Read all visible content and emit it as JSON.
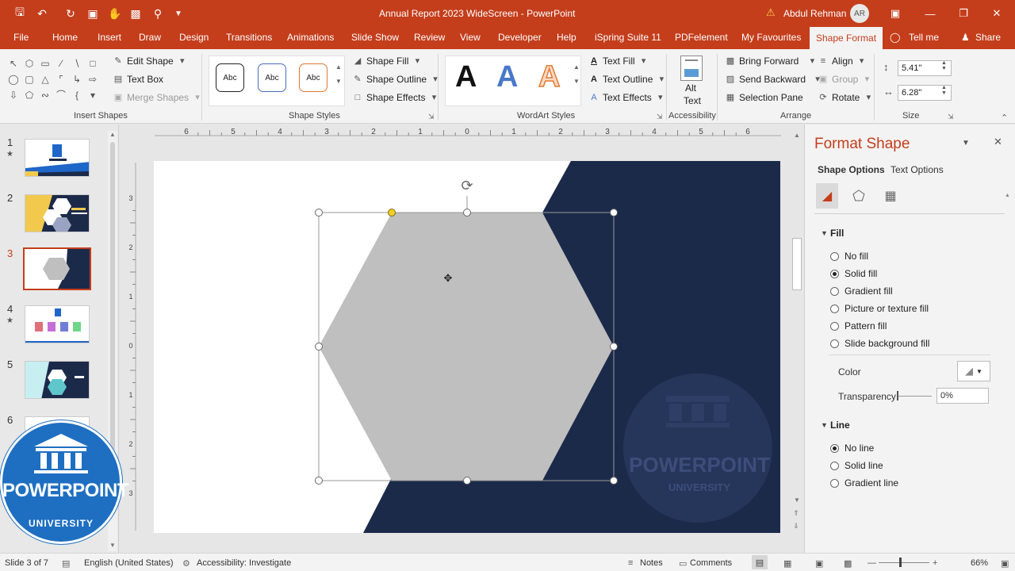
{
  "window": {
    "title": "Annual Report 2023 WideScreen  -  PowerPoint",
    "user_name": "Abdul Rehman",
    "user_initials": "AR"
  },
  "menu_tabs": [
    "File",
    "Home",
    "Insert",
    "Draw",
    "Design",
    "Transitions",
    "Animations",
    "Slide Show",
    "Review",
    "View",
    "Developer",
    "Help",
    "iSpring Suite 11",
    "PDFelement",
    "My Favourites",
    "Shape Format"
  ],
  "menu_extra": {
    "tell_me": "Tell me",
    "share": "Share"
  },
  "ribbon": {
    "insert_shapes": {
      "edit_shape": "Edit Shape",
      "text_box": "Text Box",
      "merge_shapes": "Merge Shapes",
      "label": "Insert Shapes"
    },
    "shape_styles": {
      "sample": "Abc",
      "fill": "Shape Fill",
      "outline": "Shape Outline",
      "effects": "Shape Effects",
      "label": "Shape Styles"
    },
    "wordart_styles": {
      "sample": "A",
      "text_fill": "Text Fill",
      "text_outline": "Text Outline",
      "text_effects": "Text Effects",
      "label": "WordArt Styles"
    },
    "accessibility": {
      "alt_text_1": "Alt",
      "alt_text_2": "Text",
      "label": "Accessibility"
    },
    "arrange": {
      "bring_forward": "Bring Forward",
      "send_backward": "Send Backward",
      "selection_pane": "Selection Pane",
      "align": "Align",
      "group": "Group",
      "rotate": "Rotate",
      "label": "Arrange"
    },
    "size": {
      "height": "5.41\"",
      "width": "6.28\"",
      "label": "Size"
    }
  },
  "ruler": {
    "h_labels": [
      "6",
      "5",
      "4",
      "3",
      "2",
      "1",
      "0",
      "1",
      "2",
      "3",
      "4",
      "5",
      "6"
    ],
    "v_labels": [
      "3",
      "2",
      "1",
      "0",
      "1",
      "2",
      "3"
    ]
  },
  "thumbnails": [
    {
      "num": "1",
      "star": true
    },
    {
      "num": "2",
      "star": false
    },
    {
      "num": "3",
      "star": false,
      "selected": true
    },
    {
      "num": "4",
      "star": true
    },
    {
      "num": "5",
      "star": false
    },
    {
      "num": "6",
      "star": false
    }
  ],
  "logo": {
    "line1": "POWERPOINT",
    "line2": "UNIVERSITY"
  },
  "watermark": {
    "line1": "POWERPOINT",
    "line2": "UNIVERSITY"
  },
  "pane": {
    "title": "Format Shape",
    "tabs": [
      "Shape Options",
      "Text Options"
    ],
    "fill": {
      "label": "Fill",
      "options": [
        "No fill",
        "Solid fill",
        "Gradient fill",
        "Picture or texture fill",
        "Pattern fill",
        "Slide background fill"
      ],
      "selected_index": 1,
      "color_label": "Color",
      "transparency_label": "Transparency",
      "transparency_value": "0%"
    },
    "line": {
      "label": "Line",
      "options": [
        "No line",
        "Solid line",
        "Gradient line"
      ],
      "selected_index": 0
    }
  },
  "status": {
    "slide": "Slide 3 of 7",
    "language": "English (United States)",
    "accessibility": "Accessibility: Investigate",
    "notes": "Notes",
    "comments": "Comments",
    "zoom": "66%"
  },
  "colors": {
    "accent": "#c43e1c",
    "navy": "#1c2a4a",
    "hexagon": "#bfbfbf",
    "logo_blue": "#1e6fc1"
  }
}
